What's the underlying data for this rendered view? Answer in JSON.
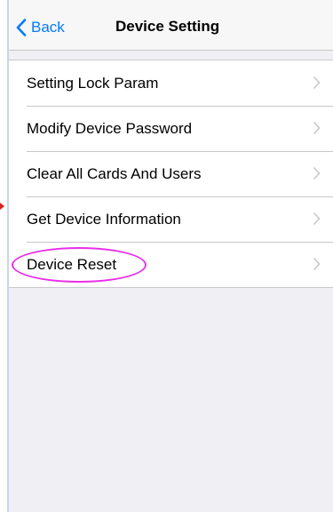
{
  "navbar": {
    "back_label": "Back",
    "title": "Device Setting",
    "accent_color": "#007aff"
  },
  "menu": {
    "items": [
      {
        "label": "Setting Lock Param"
      },
      {
        "label": "Modify Device Password"
      },
      {
        "label": "Clear All Cards And Users"
      },
      {
        "label": "Get Device Information"
      },
      {
        "label": "Device Reset"
      }
    ],
    "highlight_color": "#e82ee8"
  },
  "icons": {
    "back": "chevron-left-icon",
    "row_disclosure": "chevron-right-icon",
    "annotation": "red-arrow-marker"
  }
}
